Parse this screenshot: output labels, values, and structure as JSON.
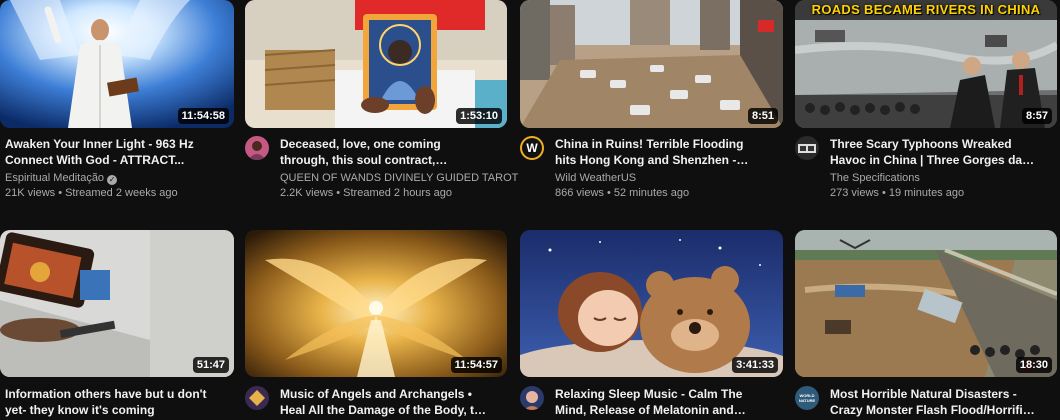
{
  "row1": [
    {
      "title": "Awaken Your Inner Light - 963 Hz Connect With God - ATTRACT...",
      "channel": "Espiritual Meditação",
      "verified": true,
      "stats": "21K views • Streamed 2 weeks ago",
      "duration": "11:54:58"
    },
    {
      "title": "Deceased, love, one coming through, this soul contract, protection, be wise...",
      "channel": "QUEEN OF WANDS DIVINELY GUIDED TAROT",
      "verified": false,
      "stats": "2.2K views • Streamed 2 hours ago",
      "duration": "1:53:10"
    },
    {
      "title": "China in Ruins! Terrible Flooding hits Hong Kong and Shenzhen - Horrific...",
      "channel": "Wild WeatherUS",
      "verified": false,
      "stats": "866 views • 52 minutes ago",
      "duration": "8:51",
      "avatar_letter": "W"
    },
    {
      "title": "Three Scary Typhoons Wreaked Havoc in China | Three Gorges dam collapse",
      "channel": "The Specifications",
      "verified": false,
      "stats": "273 views • 19 minutes ago",
      "duration": "8:57",
      "banner": "ROADS BECAME RIVERS IN CHINA"
    }
  ],
  "row2": [
    {
      "title": "Information others have but u don't yet- they know it's coming",
      "duration": "51:47"
    },
    {
      "title": "Music of Angels and Archangels • Heal All the Damage of the Body, the Soul a...",
      "duration": "11:54:57"
    },
    {
      "title": "Relaxing Sleep Music - Calm The Mind, Release of Melatonin and Toxin | Heali...",
      "duration": "3:41:33"
    },
    {
      "title": "Most Horrible Natural Disasters - Crazy Monster Flash Flood/Horrific Landslid...",
      "duration": "18:30",
      "avatar_text": "WORLD NATURE"
    }
  ],
  "colors": {
    "background": "#0f0f0f",
    "title_text": "#f1f1f1",
    "secondary_text": "#aaaaaa",
    "banner_text": "#ffd200"
  }
}
